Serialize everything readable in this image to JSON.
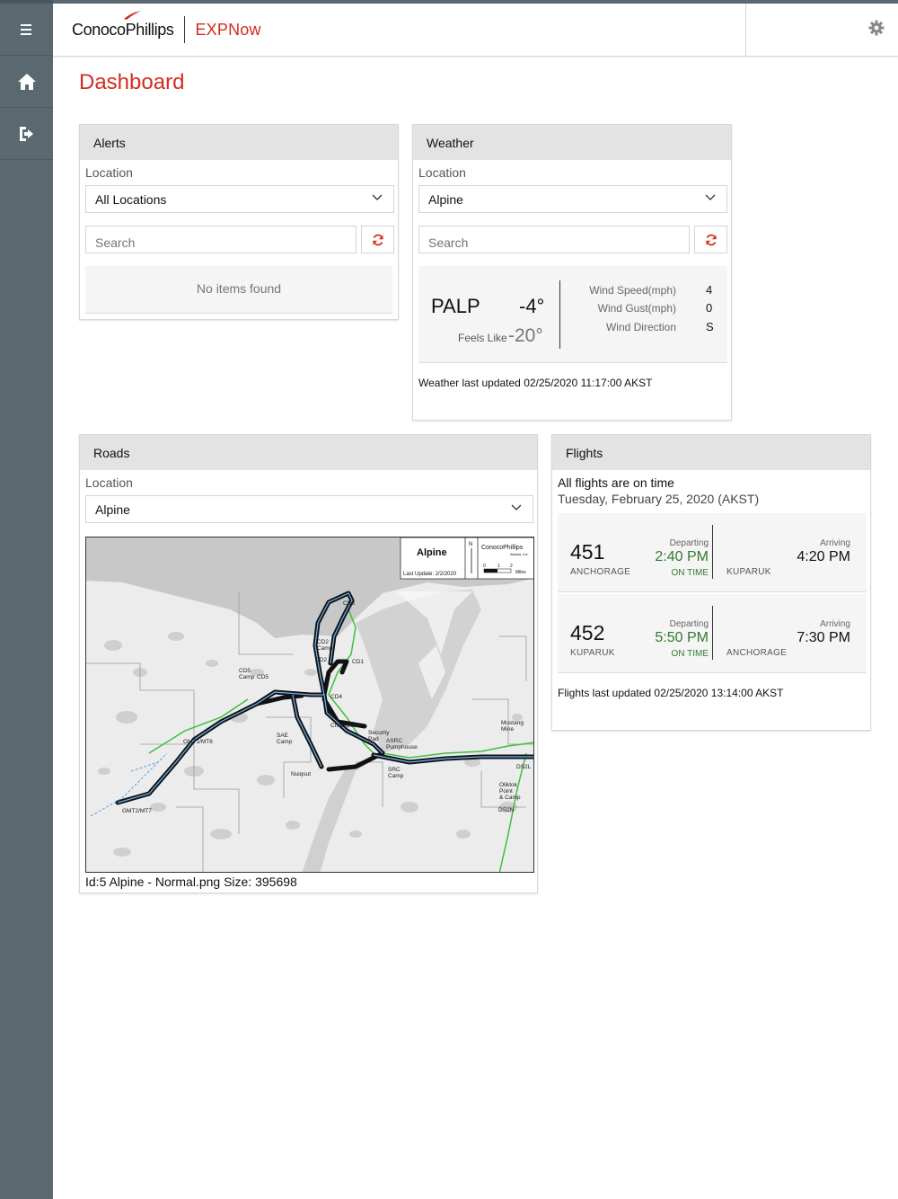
{
  "app": {
    "brand": "ConocoPhillips",
    "product": "EXPNow"
  },
  "page": {
    "title": "Dashboard"
  },
  "alerts": {
    "title": "Alerts",
    "location_label": "Location",
    "location_value": "All Locations",
    "search_placeholder": "Search",
    "empty_text": "No items found"
  },
  "weather": {
    "title": "Weather",
    "location_label": "Location",
    "location_value": "Alpine",
    "search_placeholder": "Search",
    "station": "PALP",
    "temp": "-4°",
    "feels_label": "Feels Like",
    "feels_value": "-20°",
    "wind_speed_label": "Wind Speed(mph)",
    "wind_speed_value": "4",
    "wind_gust_label": "Wind Gust(mph)",
    "wind_gust_value": "0",
    "wind_dir_label": "Wind Direction",
    "wind_dir_value": "S",
    "updated": "Weather last updated 02/25/2020 11:17:00 AKST"
  },
  "roads": {
    "title": "Roads",
    "location_label": "Location",
    "location_value": "Alpine",
    "caption": "Id:5 Alpine - Normal.png Size: 395698",
    "map": {
      "title": "Alpine",
      "last_update": "Last Update: 2/2/2020",
      "logo_text": "ConocoPhillips",
      "logo_sub": "Alaska, Inc.",
      "north": "N",
      "scale": [
        "0",
        "1",
        "2"
      ],
      "scale_unit": "Miles",
      "labels": {
        "cd3": "CD3",
        "cd2camp": "CD2\nCamp",
        "cd2": "CD2",
        "cd1": "CD1",
        "cd5camp": "CD5\nCamp",
        "cd5": "CD5",
        "cd4": "CD4",
        "checkpoint": "Checkpoint",
        "security": "Security\nPad",
        "asrc": "ASRC\nPumphouse",
        "sae": "SAE\nCamp",
        "gmt1": "GMT1/MT6",
        "gmt2": "GMT2/MT7",
        "nuiqsut": "Nuiqsut",
        "src": "SRC\nCamp",
        "mustang": "Mustang\nMine",
        "ds2l": "DS2L",
        "oliktok": "Oliktok\nPoint\n& Camp",
        "ds2n": "DS2N"
      }
    }
  },
  "flights": {
    "title": "Flights",
    "status": "All flights are on time",
    "date": "Tuesday, February 25, 2020 (AKST)",
    "departing_label": "Departing",
    "arriving_label": "Arriving",
    "items": [
      {
        "number": "451",
        "from": "ANCHORAGE",
        "dep_time": "2:40 PM",
        "status": "ON TIME",
        "to": "KUPARUK",
        "arr_time": "4:20 PM"
      },
      {
        "number": "452",
        "from": "KUPARUK",
        "dep_time": "5:50 PM",
        "status": "ON TIME",
        "to": "ANCHORAGE",
        "arr_time": "7:30 PM"
      }
    ],
    "updated": "Flights last updated 02/25/2020 13:14:00 AKST"
  }
}
